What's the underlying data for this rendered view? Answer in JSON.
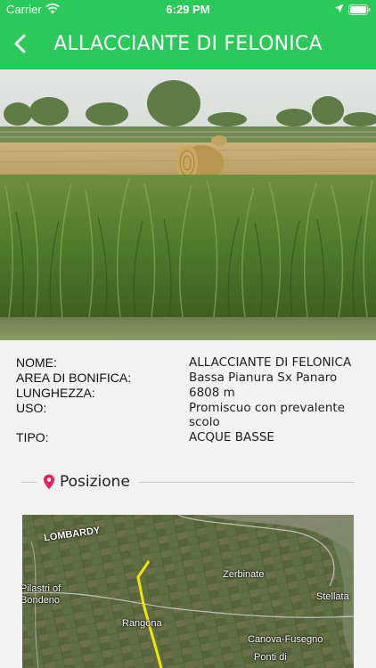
{
  "status_bar": {
    "carrier": "Carrier",
    "time": "6:29 PM"
  },
  "nav": {
    "title": "ALLACCIANTE DI FELONICA"
  },
  "info": {
    "rows": [
      {
        "label": "NOME:",
        "value": "ALLACCIANTE DI FELONICA"
      },
      {
        "label": "AREA DI BONIFICA:",
        "value": "Bassa Pianura Sx Panaro"
      },
      {
        "label": "LUNGHEZZA:",
        "value": "6808 m"
      },
      {
        "label": "USO:",
        "value": "Promiscuo con prevalente scolo"
      },
      {
        "label": "TIPO:",
        "value": "ACQUE BASSE"
      }
    ]
  },
  "position_section": {
    "title": "Posizione"
  },
  "map": {
    "labels": {
      "lombardy": "LOMBARDY",
      "pilastri": "Pilastri of Bondeno",
      "zerbinate": "Zerbinate",
      "stellata": "Stellata",
      "rangona": "Rangona",
      "canova": "Canova-Fusegno",
      "ponti": "Ponti di"
    }
  },
  "colors": {
    "accent": "#2bc95a",
    "pin": "#e91e63",
    "route": "#f2e600"
  }
}
